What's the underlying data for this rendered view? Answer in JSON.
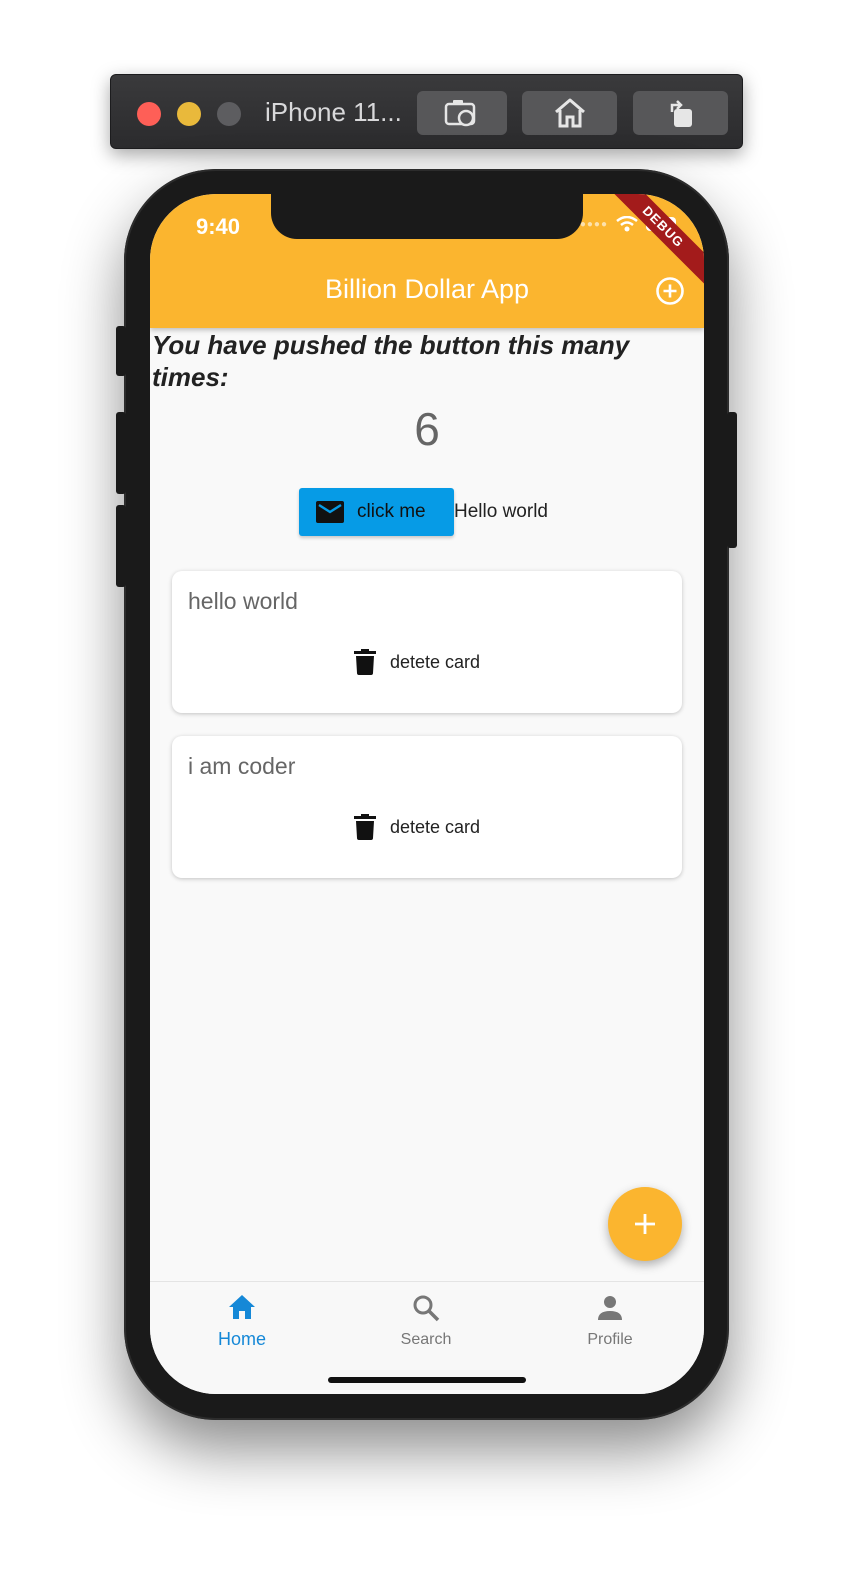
{
  "simulator": {
    "title": "iPhone 11...",
    "buttons": [
      "screenshot-icon",
      "home-icon",
      "rotate-icon"
    ]
  },
  "status_bar": {
    "time": "9:40",
    "debug_banner": "DEBUG"
  },
  "app_bar": {
    "title": "Billion Dollar App",
    "action_icon": "add-circle-icon",
    "color": "#fbb52f"
  },
  "counter": {
    "caption": "You have pushed the button this many times:",
    "value": "6"
  },
  "actions": {
    "click_button_label": "click me",
    "click_button_icon": "mail-icon",
    "click_button_color": "#069be6",
    "hello_text": "Hello world"
  },
  "cards": [
    {
      "text": "hello world",
      "button_label": "detete card",
      "button_icon": "trash-icon"
    },
    {
      "text": "i am coder",
      "button_label": "detete card",
      "button_icon": "trash-icon"
    }
  ],
  "fab": {
    "icon": "plus-icon"
  },
  "bottom_nav": {
    "items": [
      {
        "label": "Home",
        "icon": "home-icon",
        "active": true
      },
      {
        "label": "Search",
        "icon": "search-icon",
        "active": false
      },
      {
        "label": "Profile",
        "icon": "person-icon",
        "active": false
      }
    ],
    "active_color": "#1588d7"
  }
}
